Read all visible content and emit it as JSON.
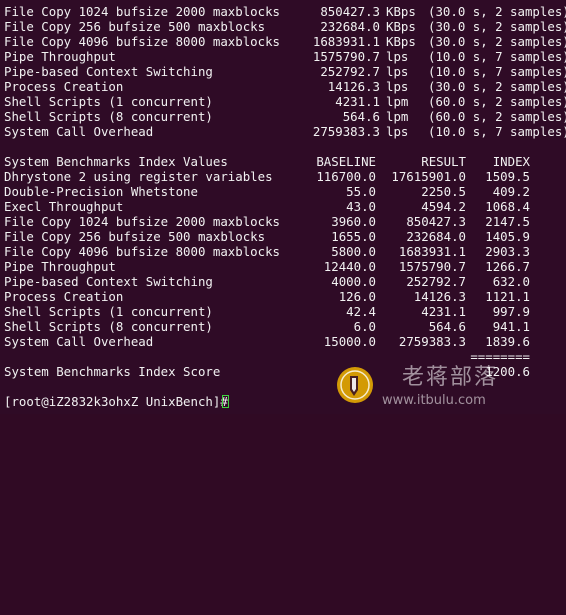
{
  "terminal": {
    "top_rows": [
      {
        "name": "File Copy 1024 bufsize 2000 maxblocks",
        "value": "850427.3",
        "unit": "KBps",
        "detail": "(30.0 s, 2 samples)"
      },
      {
        "name": "File Copy 256 bufsize 500 maxblocks",
        "value": "232684.0",
        "unit": "KBps",
        "detail": "(30.0 s, 2 samples)"
      },
      {
        "name": "File Copy 4096 bufsize 8000 maxblocks",
        "value": "1683931.1",
        "unit": "KBps",
        "detail": "(30.0 s, 2 samples)"
      },
      {
        "name": "Pipe Throughput",
        "value": "1575790.7",
        "unit": "lps",
        "detail": "(10.0 s, 7 samples)"
      },
      {
        "name": "Pipe-based Context Switching",
        "value": "252792.7",
        "unit": "lps",
        "detail": "(10.0 s, 7 samples)"
      },
      {
        "name": "Process Creation",
        "value": "14126.3",
        "unit": "lps",
        "detail": "(30.0 s, 2 samples)"
      },
      {
        "name": "Shell Scripts (1 concurrent)",
        "value": "4231.1",
        "unit": "lpm",
        "detail": "(60.0 s, 2 samples)"
      },
      {
        "name": "Shell Scripts (8 concurrent)",
        "value": "564.6",
        "unit": "lpm",
        "detail": "(60.0 s, 2 samples)"
      },
      {
        "name": "System Call Overhead",
        "value": "2759383.3",
        "unit": "lps",
        "detail": "(10.0 s, 7 samples)"
      }
    ],
    "index_header": {
      "title": "System Benchmarks Index Values",
      "baseline": "BASELINE",
      "result": "RESULT",
      "index": "INDEX"
    },
    "index_rows": [
      {
        "name": "Dhrystone 2 using register variables",
        "baseline": "116700.0",
        "result": "17615901.0",
        "index": "1509.5"
      },
      {
        "name": "Double-Precision Whetstone",
        "baseline": "55.0",
        "result": "2250.5",
        "index": "409.2"
      },
      {
        "name": "Execl Throughput",
        "baseline": "43.0",
        "result": "4594.2",
        "index": "1068.4"
      },
      {
        "name": "File Copy 1024 bufsize 2000 maxblocks",
        "baseline": "3960.0",
        "result": "850427.3",
        "index": "2147.5"
      },
      {
        "name": "File Copy 256 bufsize 500 maxblocks",
        "baseline": "1655.0",
        "result": "232684.0",
        "index": "1405.9"
      },
      {
        "name": "File Copy 4096 bufsize 8000 maxblocks",
        "baseline": "5800.0",
        "result": "1683931.1",
        "index": "2903.3"
      },
      {
        "name": "Pipe Throughput",
        "baseline": "12440.0",
        "result": "1575790.7",
        "index": "1266.7"
      },
      {
        "name": "Pipe-based Context Switching",
        "baseline": "4000.0",
        "result": "252792.7",
        "index": "632.0"
      },
      {
        "name": "Process Creation",
        "baseline": "126.0",
        "result": "14126.3",
        "index": "1121.1"
      },
      {
        "name": "Shell Scripts (1 concurrent)",
        "baseline": "42.4",
        "result": "4231.1",
        "index": "997.9"
      },
      {
        "name": "Shell Scripts (8 concurrent)",
        "baseline": "6.0",
        "result": "564.6",
        "index": "941.1"
      },
      {
        "name": "System Call Overhead",
        "baseline": "15000.0",
        "result": "2759383.3",
        "index": "1839.6"
      }
    ],
    "separator": "========",
    "score_label": "System Benchmarks Index Score",
    "score_value": "1200.6",
    "prompt": "[root@iZ2832k3ohxZ UnixBench]#"
  },
  "watermark": {
    "site_name": "老蒋部落",
    "url": "www.itbulu.com",
    "accent_color": "#f0b400"
  },
  "colors": {
    "background": "#2f0b26",
    "text": "#f2f2f2",
    "cursor": "#3fd33f"
  }
}
